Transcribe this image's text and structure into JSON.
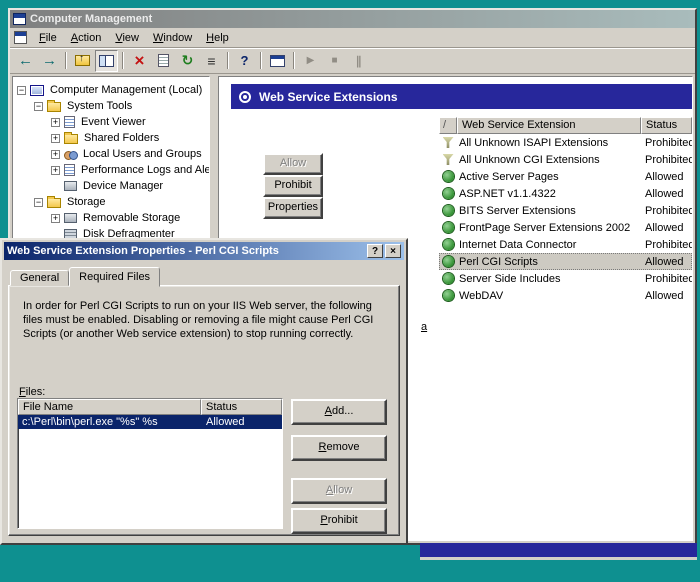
{
  "colors": {
    "desktop_teal": "#0e9090",
    "chrome_gray": "#d4d0c8",
    "titlebar_inactive_left": "#7f7f7f",
    "titlebar_inactive_right": "#a9bcbc",
    "dialog_titlebar_left": "#0a246a",
    "dialog_titlebar_right": "#9cc0ea",
    "taskpad_header_blue": "#27279b",
    "selection_navy": "#0a246a",
    "allowed_gear_green": "#2f8f2f",
    "delete_red": "#c41212"
  },
  "window": {
    "title": "Computer Management",
    "menu_items": [
      "File",
      "Action",
      "View",
      "Window",
      "Help"
    ],
    "toolbar": [
      {
        "icon": "back-icon",
        "enabled": true
      },
      {
        "icon": "forward-icon",
        "enabled": true
      },
      {
        "sep": true
      },
      {
        "icon": "up-icon",
        "enabled": true
      },
      {
        "icon": "show-tree-icon",
        "enabled": true,
        "pressed": true
      },
      {
        "sep": true
      },
      {
        "icon": "delete-icon",
        "enabled": true
      },
      {
        "icon": "properties-icon",
        "enabled": true
      },
      {
        "icon": "refresh-icon",
        "enabled": true
      },
      {
        "icon": "export-list-icon",
        "enabled": true
      },
      {
        "sep": true
      },
      {
        "icon": "help-icon",
        "enabled": true
      },
      {
        "sep": true
      },
      {
        "icon": "window-icon",
        "enabled": true
      },
      {
        "sep": true
      },
      {
        "icon": "play-icon",
        "enabled": false
      },
      {
        "icon": "stop-icon",
        "enabled": false
      },
      {
        "icon": "pause-icon",
        "enabled": false
      }
    ]
  },
  "tree": {
    "items": [
      {
        "label": "Computer Management (Local)",
        "indent": 0,
        "expand": "minus",
        "icon": "computer-icon"
      },
      {
        "label": "System Tools",
        "indent": 1,
        "expand": "minus",
        "icon": "folder-icon"
      },
      {
        "label": "Event Viewer",
        "indent": 2,
        "expand": "plus",
        "icon": "event-viewer-icon"
      },
      {
        "label": "Shared Folders",
        "indent": 2,
        "expand": "plus",
        "icon": "shared-folders-icon"
      },
      {
        "label": "Local Users and Groups",
        "indent": 2,
        "expand": "plus",
        "icon": "users-icon"
      },
      {
        "label": "Performance Logs and Ale",
        "indent": 2,
        "expand": "plus",
        "icon": "performance-icon"
      },
      {
        "label": "Device Manager",
        "indent": 2,
        "expand": "none",
        "icon": "device-manager-icon"
      },
      {
        "label": "Storage",
        "indent": 1,
        "expand": "minus",
        "icon": "folder-icon"
      },
      {
        "label": "Removable Storage",
        "indent": 2,
        "expand": "plus",
        "icon": "removable-storage-icon"
      },
      {
        "label": "Disk Defragmenter",
        "indent": 2,
        "expand": "none",
        "icon": "disk-defrag-icon"
      }
    ]
  },
  "taskpad": {
    "header": "Web Service Extensions",
    "action_buttons": [
      {
        "label": "Allow",
        "enabled": false
      },
      {
        "label": "Prohibit",
        "enabled": true
      },
      {
        "label": "Properties",
        "enabled": true
      }
    ],
    "list": {
      "columns": [
        "Web Service Extension",
        "Status"
      ],
      "rows": [
        {
          "name": "All Unknown ISAPI Extensions",
          "status": "Prohibited",
          "icon": "funnel-icon",
          "selected": false
        },
        {
          "name": "All Unknown CGI Extensions",
          "status": "Prohibited",
          "icon": "funnel-icon",
          "selected": false
        },
        {
          "name": "Active Server Pages",
          "status": "Allowed",
          "icon": "gear-icon",
          "selected": false
        },
        {
          "name": "ASP.NET v1.1.4322",
          "status": "Allowed",
          "icon": "gear-icon",
          "selected": false
        },
        {
          "name": "BITS Server Extensions",
          "status": "Prohibited",
          "icon": "gear-icon",
          "selected": false
        },
        {
          "name": "FrontPage Server Extensions 2002",
          "status": "Allowed",
          "icon": "gear-icon",
          "selected": false
        },
        {
          "name": "Internet Data Connector",
          "status": "Prohibited",
          "icon": "gear-icon",
          "selected": false
        },
        {
          "name": "Perl CGI Scripts",
          "status": "Allowed",
          "icon": "gear-icon",
          "selected": true
        },
        {
          "name": "Server Side Includes",
          "status": "Prohibited",
          "icon": "gear-icon",
          "selected": false
        },
        {
          "name": "WebDAV",
          "status": "Allowed",
          "icon": "gear-icon",
          "selected": false
        }
      ]
    },
    "link_fragment": "a"
  },
  "dialog": {
    "title": "Web Service Extension Properties - Perl CGI Scripts",
    "help_glyph": "?",
    "close_glyph": "×",
    "tabs": [
      "General",
      "Required Files"
    ],
    "active_tab": "Required Files",
    "description": "In order for Perl CGI Scripts to run on your IIS Web server, the following files must be enabled.  Disabling or removing a file might cause Perl CGI Scripts (or another Web service extension) to stop running correctly.",
    "files_label": "Files:",
    "file_list": {
      "columns": [
        "File Name",
        "Status"
      ],
      "rows": [
        {
          "file": "c:\\Perl\\bin\\perl.exe \"%s\" %s",
          "status": "Allowed",
          "selected": true
        }
      ]
    },
    "buttons": [
      {
        "label": "Add...",
        "enabled": true
      },
      {
        "label": "Remove",
        "enabled": true
      },
      {
        "label": "Allow",
        "enabled": false
      },
      {
        "label": "Prohibit",
        "enabled": true
      }
    ]
  }
}
